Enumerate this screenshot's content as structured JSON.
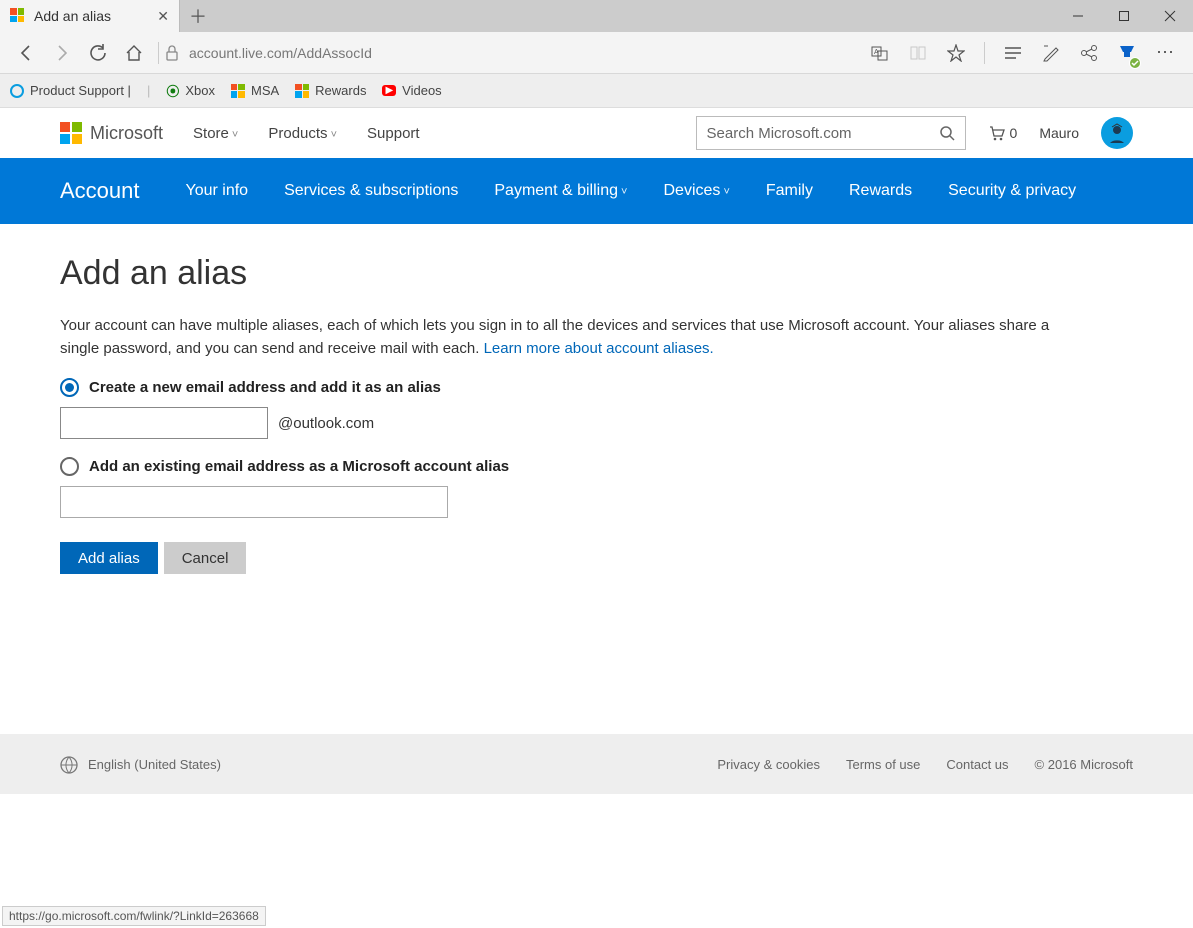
{
  "browser": {
    "tab_title": "Add an alias",
    "url": "account.live.com/AddAssocId",
    "status_url": "https://go.microsoft.com/fwlink/?LinkId=263668"
  },
  "favorites": [
    {
      "label": "Product Support |"
    },
    {
      "label": "Xbox"
    },
    {
      "label": "MSA"
    },
    {
      "label": "Rewards"
    },
    {
      "label": "Videos"
    }
  ],
  "ms_header": {
    "brand": "Microsoft",
    "nav": [
      "Store",
      "Products",
      "Support"
    ],
    "search_placeholder": "Search Microsoft.com",
    "cart_count": "0",
    "username": "Mauro"
  },
  "account_nav": {
    "brand": "Account",
    "items": [
      "Your info",
      "Services & subscriptions",
      "Payment & billing",
      "Devices",
      "Family",
      "Rewards",
      "Security & privacy"
    ]
  },
  "page": {
    "title": "Add an alias",
    "description": "Your account can have multiple aliases, each of which lets you sign in to all the devices and services that use Microsoft account. Your aliases share a single password, and you can send and receive mail with each. ",
    "learn_more": "Learn more about account aliases.",
    "option1_label": "Create a new email address and add it as an alias",
    "email_suffix": "@outlook.com",
    "option2_label": "Add an existing email address as a Microsoft account alias",
    "new_email_value": "",
    "existing_email_value": "",
    "add_button": "Add alias",
    "cancel_button": "Cancel"
  },
  "footer": {
    "language": "English (United States)",
    "links": [
      "Privacy & cookies",
      "Terms of use",
      "Contact us"
    ],
    "copyright": "© 2016 Microsoft"
  }
}
